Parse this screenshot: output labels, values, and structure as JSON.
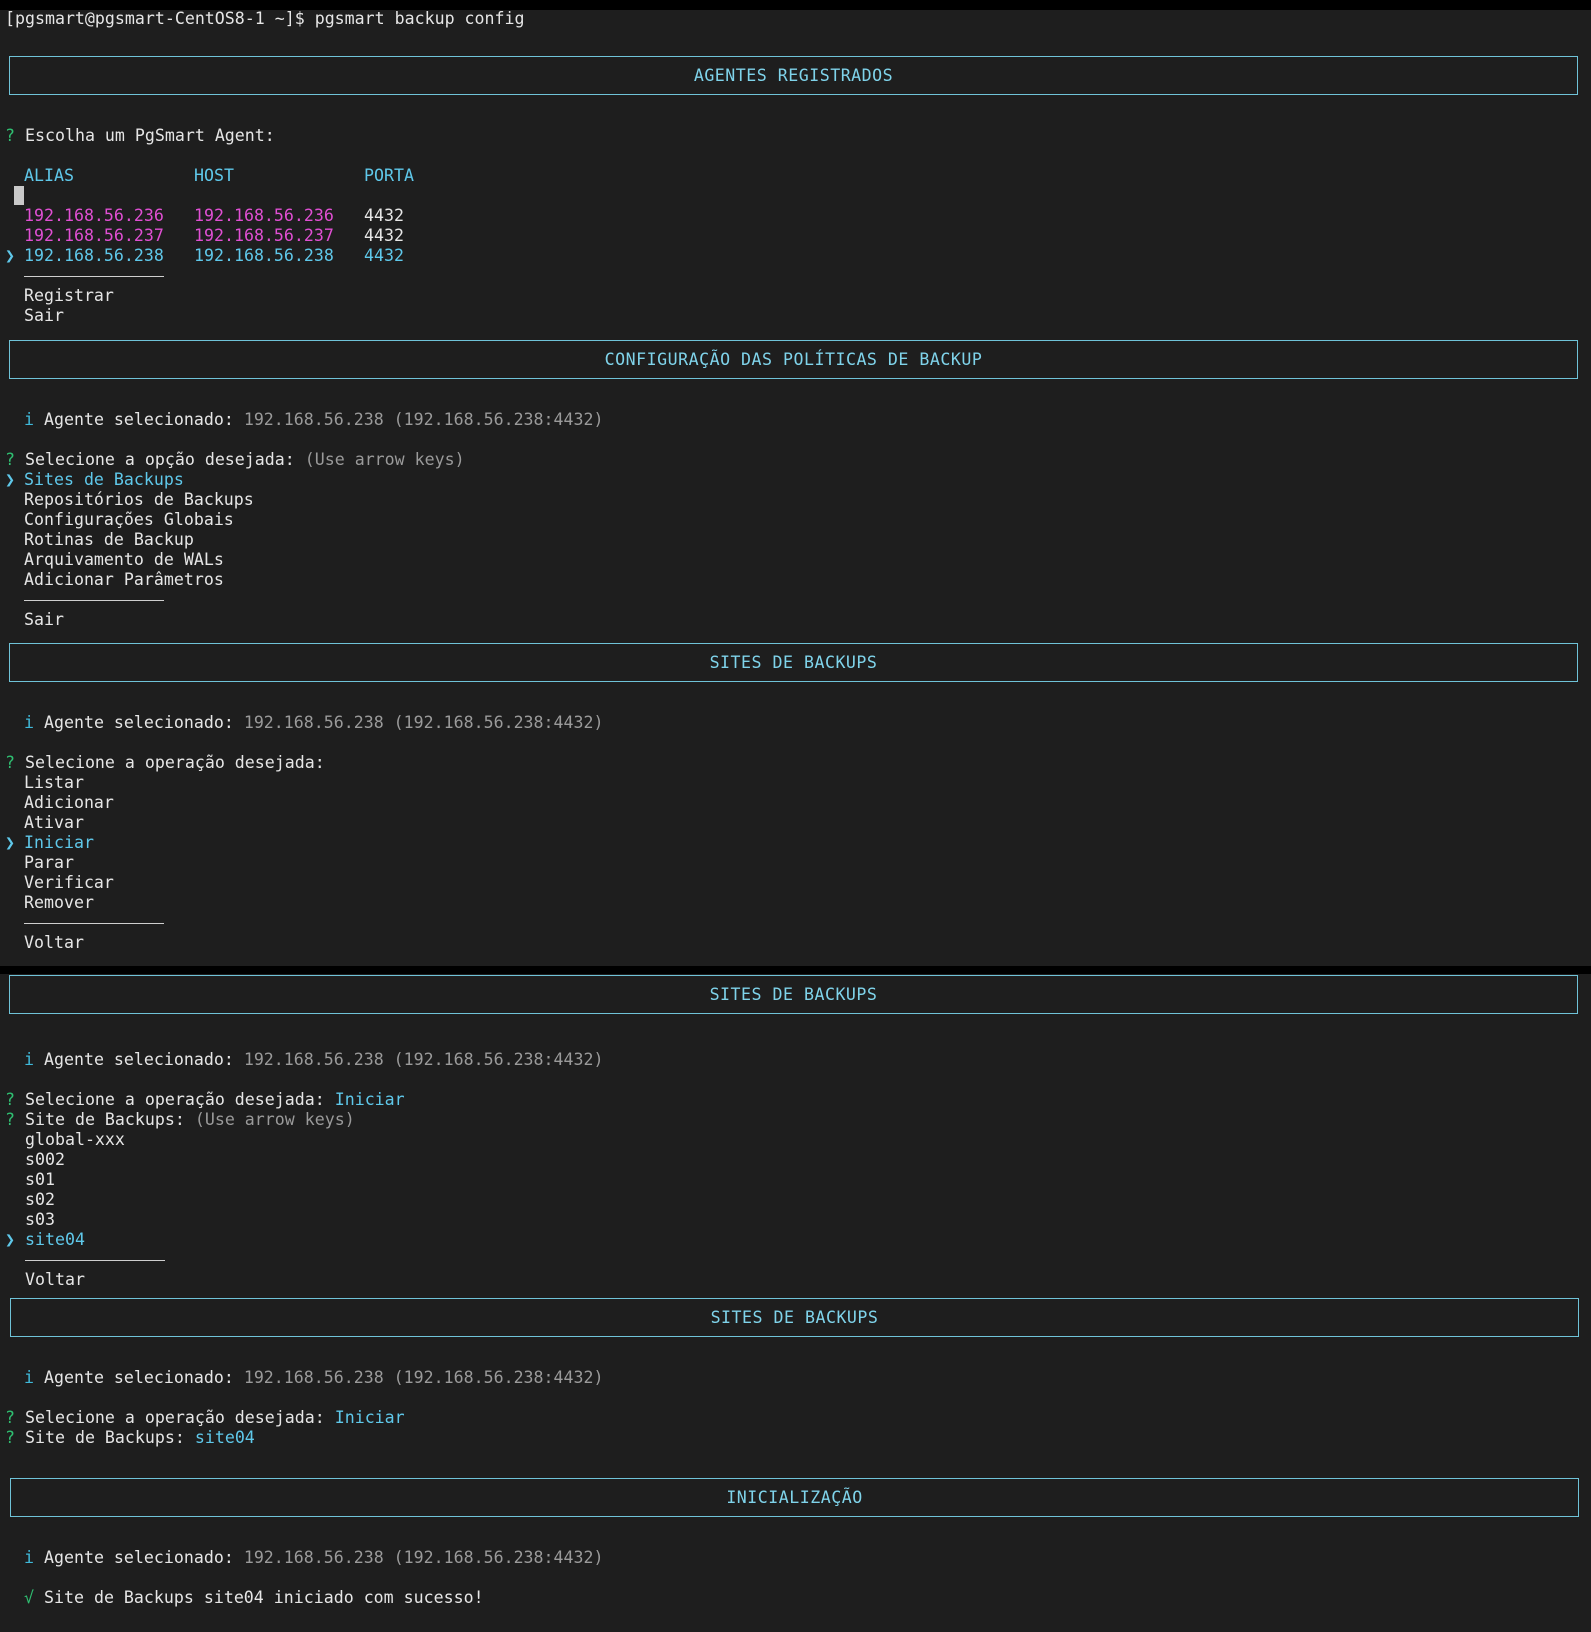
{
  "prompt_line": "[pgsmart@pgsmart-CentOS8-1 ~]$ pgsmart backup config",
  "icons": {
    "question": "?",
    "info": "i",
    "pointer": "❯",
    "check": "√"
  },
  "section1": {
    "title": "AGENTES REGISTRADOS",
    "question": "Escolha um PgSmart Agent:",
    "headers": {
      "alias": "ALIAS",
      "host": "HOST",
      "porta": "PORTA"
    },
    "rows": [
      {
        "alias": "192.168.56.236",
        "host": "192.168.56.236",
        "porta": "4432"
      },
      {
        "alias": "192.168.56.237",
        "host": "192.168.56.237",
        "porta": "4432"
      },
      {
        "alias": "192.168.56.238",
        "host": "192.168.56.238",
        "porta": "4432",
        "selected": true
      }
    ],
    "extra": [
      "Registrar",
      "Sair"
    ]
  },
  "section2": {
    "title": "CONFIGURAÇÃO DAS POLÍTICAS DE BACKUP",
    "agent_label": "Agente selecionado:",
    "agent_value": "192.168.56.238 (192.168.56.238:4432)",
    "question": "Selecione a opção desejada:",
    "hint": "(Use arrow keys)",
    "options": [
      "Sites de Backups",
      "Repositórios de Backups",
      "Configurações Globais",
      "Rotinas de Backup",
      "Arquivamento de WALs",
      "Adicionar Parâmetros"
    ],
    "exit": "Sair"
  },
  "section3": {
    "title": "SITES DE BACKUPS",
    "agent_label": "Agente selecionado:",
    "agent_value": "192.168.56.238 (192.168.56.238:4432)",
    "question": "Selecione a operação desejada:",
    "options": [
      "Listar",
      "Adicionar",
      "Ativar",
      "Iniciar",
      "Parar",
      "Verificar",
      "Remover"
    ],
    "back": "Voltar"
  },
  "section4": {
    "title": "SITES DE BACKUPS",
    "agent_label": "Agente selecionado:",
    "agent_value": "192.168.56.238 (192.168.56.238:4432)",
    "question": "Selecione a operação desejada:",
    "answer": "Iniciar",
    "question2": "Site de Backups:",
    "hint": "(Use arrow keys)",
    "sites": [
      "global-xxx",
      "s002",
      "s01",
      "s02",
      "s03",
      "site04"
    ],
    "back": "Voltar"
  },
  "section5": {
    "title": "SITES DE BACKUPS",
    "agent_label": "Agente selecionado:",
    "agent_value": "192.168.56.238 (192.168.56.238:4432)",
    "question": "Selecione a operação desejada:",
    "answer": "Iniciar",
    "question2": "Site de Backups:",
    "answer2": "site04"
  },
  "section6": {
    "title": "INICIALIZAÇÃO",
    "agent_label": "Agente selecionado:",
    "agent_value": "192.168.56.238 (192.168.56.238:4432)",
    "success": "Site de Backups site04 iniciado com sucesso!"
  }
}
